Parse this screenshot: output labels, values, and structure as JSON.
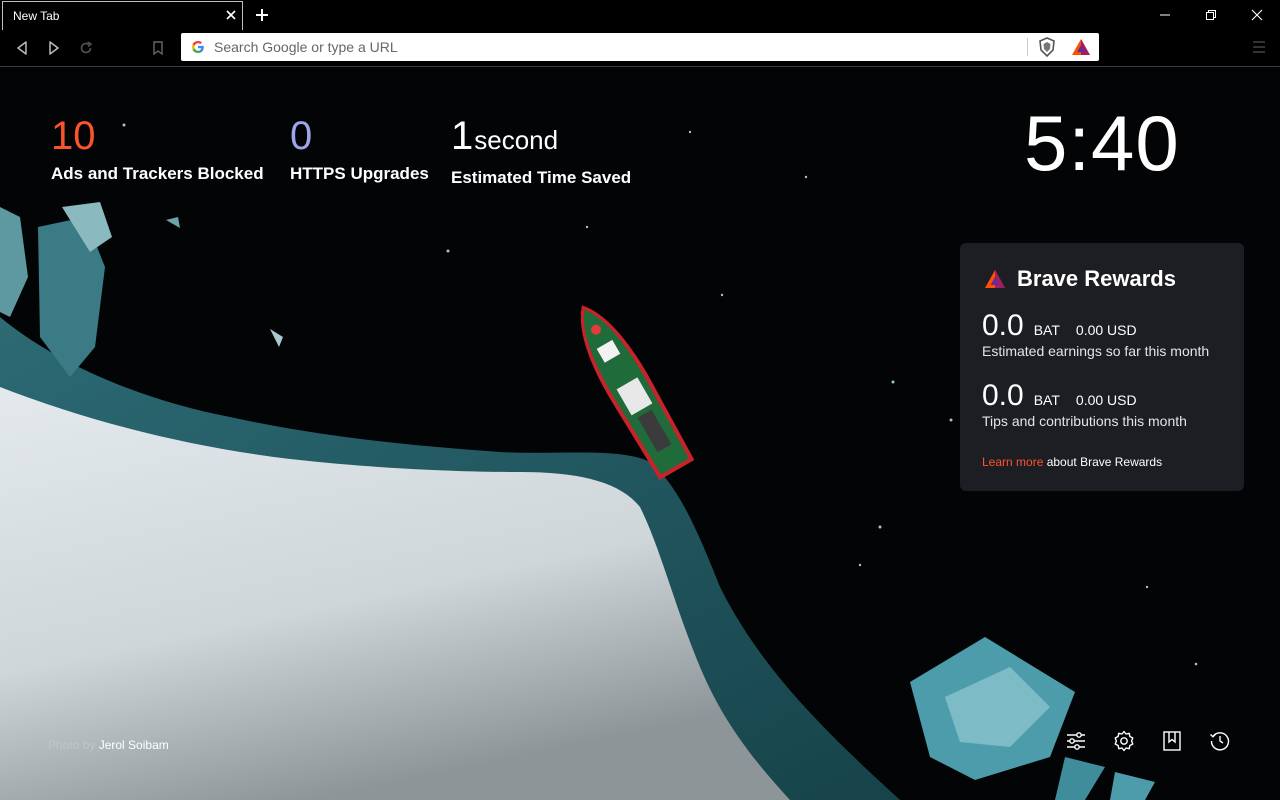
{
  "browser": {
    "tab_title": "New Tab",
    "omnibox_placeholder": "Search Google or type a URL",
    "icons": {
      "tab_close": "close-icon",
      "new_tab": "plus-icon",
      "minimize": "minimize-icon",
      "restore": "restore-icon",
      "close": "close-icon",
      "back": "back-icon",
      "forward": "forward-icon",
      "reload": "reload-icon",
      "bookmark": "bookmark-icon",
      "google": "google-icon",
      "shield": "brave-shield-icon",
      "rewards": "bat-triangle-icon",
      "menu": "hamburger-menu-icon"
    }
  },
  "stats": [
    {
      "value": "10",
      "unit": "",
      "label": "Ads and Trackers Blocked",
      "color": "#fb542b"
    },
    {
      "value": "0",
      "unit": "",
      "label": "HTTPS Upgrades",
      "color": "#a0a5eb"
    },
    {
      "value": "1",
      "unit": "second",
      "label": "Estimated Time Saved",
      "color": "#ffffff"
    }
  ],
  "clock": "5:40",
  "rewards": {
    "title": "Brave Rewards",
    "rows": [
      {
        "amount": "0.0",
        "currency": "BAT",
        "usd": "0.00 USD",
        "desc": "Estimated earnings so far this month"
      },
      {
        "amount": "0.0",
        "currency": "BAT",
        "usd": "0.00 USD",
        "desc": "Tips and contributions this month"
      }
    ],
    "learn_link": "Learn more",
    "learn_suffix": " about Brave Rewards",
    "accent_color": "#fb542b"
  },
  "credit": {
    "prefix": "Photo by ",
    "author": "Jerol Soibam"
  },
  "footer_icons": [
    "customize-sliders-icon",
    "settings-gear-icon",
    "bookmarks-icon",
    "history-icon"
  ]
}
